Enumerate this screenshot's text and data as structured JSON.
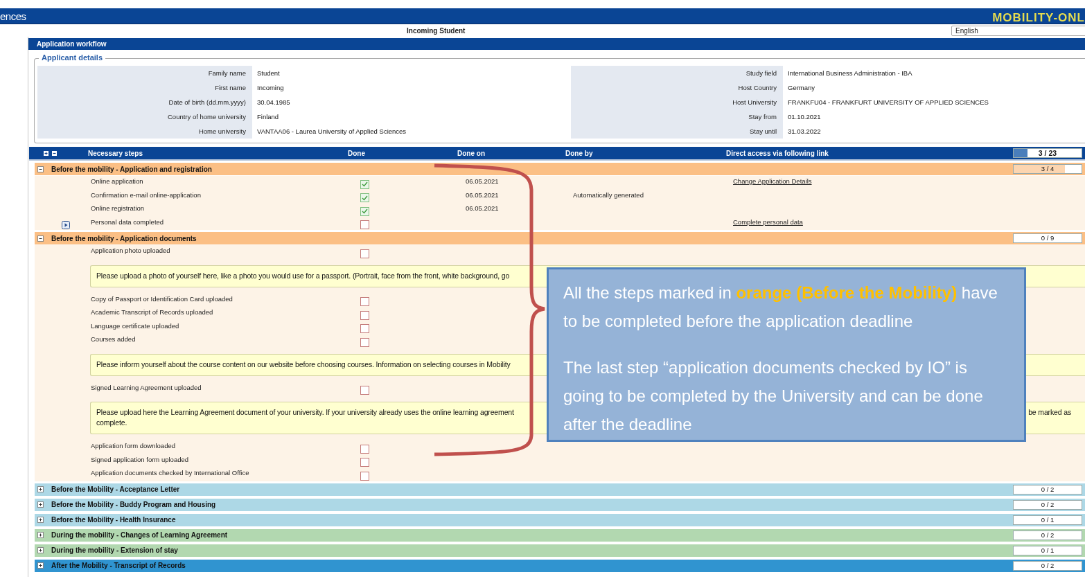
{
  "top_bar": {
    "site_title": "ences",
    "logo": "MOBILITY-ONL"
  },
  "subheader": {
    "title": "Incoming Student",
    "language": "English"
  },
  "panel": {
    "title": "Application workflow"
  },
  "applicant_details": {
    "legend": "Applicant details",
    "left": [
      {
        "label": "Family name",
        "value": "Student"
      },
      {
        "label": "First name",
        "value": "Incoming"
      },
      {
        "label": "Date of birth (dd.mm.yyyy)",
        "value": "30.04.1985"
      },
      {
        "label": "Country of home university",
        "value": "Finland"
      },
      {
        "label": "Home university",
        "value": "VANTAA06 - Laurea University of Applied Sciences"
      }
    ],
    "right": [
      {
        "label": "Study field",
        "value": "International Business Administration - IBA"
      },
      {
        "label": "Host Country",
        "value": "Germany"
      },
      {
        "label": "Host University",
        "value": "FRANKFU04 - FRANKFURT UNIVERSITY OF APPLIED SCIENCES"
      },
      {
        "label": "Stay from",
        "value": "01.10.2021"
      },
      {
        "label": "Stay until",
        "value": "31.03.2022"
      }
    ]
  },
  "steps_table": {
    "columns": [
      "Necessary steps",
      "Done",
      "Done on",
      "Done by",
      "Direct access via following link"
    ],
    "progress": "3 / 23",
    "level": 0.2,
    "groups": [
      {
        "title": "Before the mobility - Application and registration",
        "color": "#fbbf85",
        "expanded": true,
        "progress": "3 / 4",
        "level": 0.75,
        "items": [
          {
            "kind": "step",
            "name": "Online application",
            "checked": true,
            "current": false,
            "done_on": "06.05.2021",
            "link": "Change Application Details"
          },
          {
            "kind": "step",
            "name": "Confirmation e-mail online-application",
            "checked": true,
            "current": false,
            "done_on": "06.05.2021",
            "done_by": "Automatically generated"
          },
          {
            "kind": "step",
            "name": "Online registration",
            "checked": true,
            "current": false,
            "done_on": "06.05.2021"
          },
          {
            "kind": "step",
            "name": "Personal data completed",
            "checked": false,
            "current": true,
            "link": "Complete personal data"
          }
        ]
      },
      {
        "title": "Before the mobility - Application documents",
        "color": "#fbbf85",
        "expanded": true,
        "progress": "0 / 9",
        "level": 0,
        "items": [
          {
            "kind": "step",
            "name": "Application photo uploaded",
            "checked": false,
            "current": false
          },
          {
            "kind": "hint",
            "text": "Please upload a photo of yourself here, like a photo you would use for a passport. (Portrait, face from the front, white background, go"
          },
          {
            "kind": "step",
            "name": "Copy of Passport or Identification Card uploaded",
            "checked": false,
            "current": false
          },
          {
            "kind": "step",
            "name": "Academic Transcript of Records uploaded",
            "checked": false,
            "current": false
          },
          {
            "kind": "step",
            "name": "Language certificate uploaded",
            "checked": false,
            "current": false
          },
          {
            "kind": "step",
            "name": "Courses added",
            "checked": false,
            "current": false
          },
          {
            "kind": "hint",
            "text": "Please inform yourself about the course content on our website before choosing courses. Information on selecting courses in Mobility"
          },
          {
            "kind": "step",
            "name": "Signed Learning Agreement uploaded",
            "checked": false,
            "current": false
          },
          {
            "kind": "hint",
            "text": "Please upload here the Learning Agreement document of your university. If your university already uses the online learning agreement",
            "text_end": "be marked as",
            "continuation": "complete."
          },
          {
            "kind": "step",
            "name": "Application form downloaded",
            "checked": false,
            "current": false
          },
          {
            "kind": "step",
            "name": "Signed application form uploaded",
            "checked": false,
            "current": false
          },
          {
            "kind": "step",
            "name": "Application documents checked by International Office",
            "checked": false,
            "current": false
          }
        ]
      },
      {
        "title": "Before the Mobility - Acceptance Letter",
        "color": "#add8e6",
        "expanded": false,
        "progress": "0 / 2",
        "level": 0
      },
      {
        "title": "Before the Mobility - Buddy Program and Housing",
        "color": "#add8e6",
        "expanded": false,
        "progress": "0 / 2",
        "level": 0
      },
      {
        "title": "Before the Mobility - Health Insurance",
        "color": "#add8e6",
        "expanded": false,
        "progress": "0 / 1",
        "level": 0
      },
      {
        "title": "During the mobility - Changes of Learning Agreement",
        "color": "#b2d8b0",
        "expanded": false,
        "progress": "0 / 2",
        "level": 0
      },
      {
        "title": "During the mobility - Extension of stay",
        "color": "#b2d8b0",
        "expanded": false,
        "progress": "0 / 1",
        "level": 0
      },
      {
        "title": "After the Mobility - Transcript of Records",
        "color": "#3094d0",
        "expanded": false,
        "progress": "0 / 2",
        "level": 0
      }
    ]
  },
  "callout": {
    "paragraphs": [
      {
        "parts": [
          {
            "kind": "plain",
            "text": "All the steps marked in "
          },
          {
            "kind": "highlight",
            "text": "orange (Before the Mobility)"
          },
          {
            "kind": "plain",
            "text": " have to be completed before the application deadline"
          }
        ]
      },
      {
        "parts": [
          {
            "kind": "plain",
            "text": "The last step “application documents checked by IO” is going to be completed by the University and can be done after the deadline"
          }
        ]
      }
    ]
  }
}
